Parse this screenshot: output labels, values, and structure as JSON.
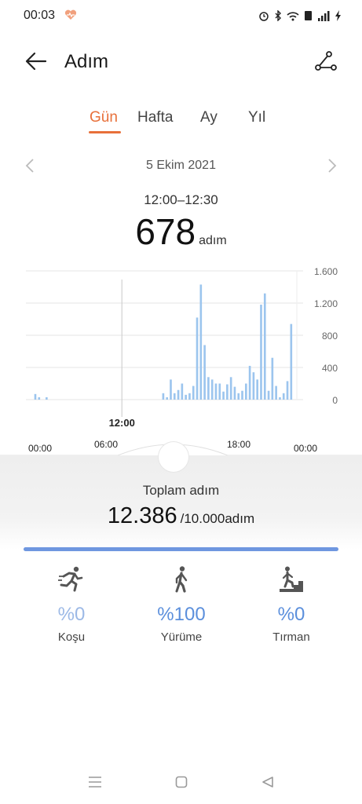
{
  "status_bar": {
    "time": "00:03"
  },
  "header": {
    "title": "Adım"
  },
  "tabs": [
    {
      "label": "Gün",
      "active": true
    },
    {
      "label": "Hafta",
      "active": false
    },
    {
      "label": "Ay",
      "active": false
    },
    {
      "label": "Yıl",
      "active": false
    }
  ],
  "date_nav": {
    "date": "5 Ekim 2021"
  },
  "selection": {
    "range": "12:00–12:30",
    "value": "678",
    "unit": "adım"
  },
  "chart_data": {
    "type": "bar",
    "y_ticks": [
      "1.600",
      "1.200",
      "800",
      "400",
      "0"
    ],
    "ylim": [
      0,
      1600
    ],
    "x_ticks": [
      "00:00",
      "06:00",
      "12:00",
      "18:00",
      "00:00"
    ],
    "selected_label": "12:00",
    "selected_index": 25,
    "bar_color": "#9cc5ee",
    "selected_color": "#2f6fd6",
    "values": [
      0,
      0,
      70,
      30,
      0,
      30,
      0,
      0,
      0,
      0,
      0,
      0,
      0,
      0,
      0,
      0,
      0,
      0,
      0,
      0,
      0,
      0,
      0,
      0,
      0,
      0,
      0,
      0,
      0,
      0,
      0,
      0,
      0,
      0,
      0,
      0,
      80,
      30,
      250,
      80,
      120,
      200,
      60,
      80,
      170,
      1020,
      1430,
      678,
      280,
      250,
      200,
      200,
      100,
      190,
      280,
      160,
      80,
      110,
      200,
      420,
      340,
      250,
      1180,
      1320,
      110,
      520,
      170,
      30,
      80,
      230,
      940,
      0
    ]
  },
  "summary": {
    "total_label": "Toplam adım",
    "total_value": "12.386",
    "goal": "/10.000adım",
    "progress": 1.0
  },
  "activities": [
    {
      "icon": "running-icon",
      "percent": "%0",
      "label": "Koşu"
    },
    {
      "icon": "walking-icon",
      "percent": "%100",
      "label": "Yürüme"
    },
    {
      "icon": "climbing-icon",
      "percent": "%0",
      "label": "Tırman"
    }
  ],
  "colors": {
    "accent": "#e8703a",
    "blue": "#6f97e0",
    "light_blue": "#9cb9e6"
  }
}
